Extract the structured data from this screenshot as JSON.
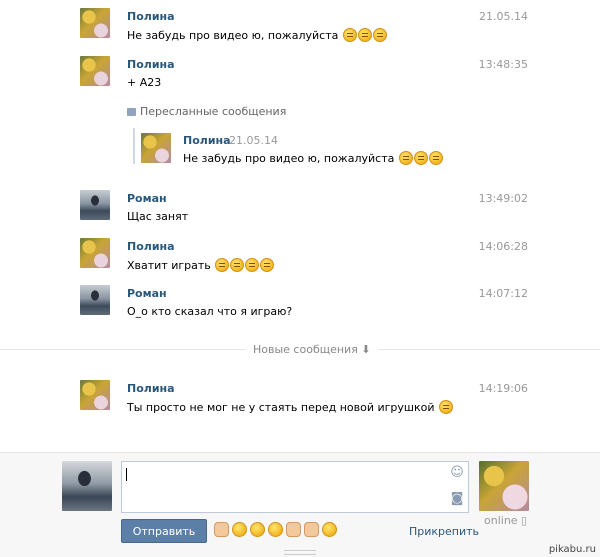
{
  "messages": [
    {
      "author": "Полина",
      "time": "21.05.14",
      "text": "Не забудь про видео ю, пожалуйста",
      "smileys": 3
    },
    {
      "author": "Полина",
      "time": "13:48:35",
      "text": "+ А23"
    },
    {
      "author": "Роман",
      "time": "13:49:02",
      "text": "Щас занят"
    },
    {
      "author": "Полина",
      "time": "14:06:28",
      "text": "Хватит играть",
      "smileys": 4
    },
    {
      "author": "Роман",
      "time": "14:07:12",
      "text": "О_о кто сказал что я играю?"
    },
    {
      "author": "Полина",
      "time": "14:19:06",
      "text": "Ты просто не мог не у стаять перед новой игрушкой",
      "smileys": 1
    }
  ],
  "forwarded": {
    "label": "Пересланные сообщения",
    "author": "Полина",
    "date": "21.05.14",
    "text": "Не забудь про видео ю, пожалуйста",
    "smileys": 3
  },
  "divider": {
    "label": "Новые сообщения ⬇"
  },
  "compose": {
    "send_label": "Отправить",
    "attach_label": "Прикрепить",
    "status": "online"
  },
  "watermark": "pikabu.ru"
}
